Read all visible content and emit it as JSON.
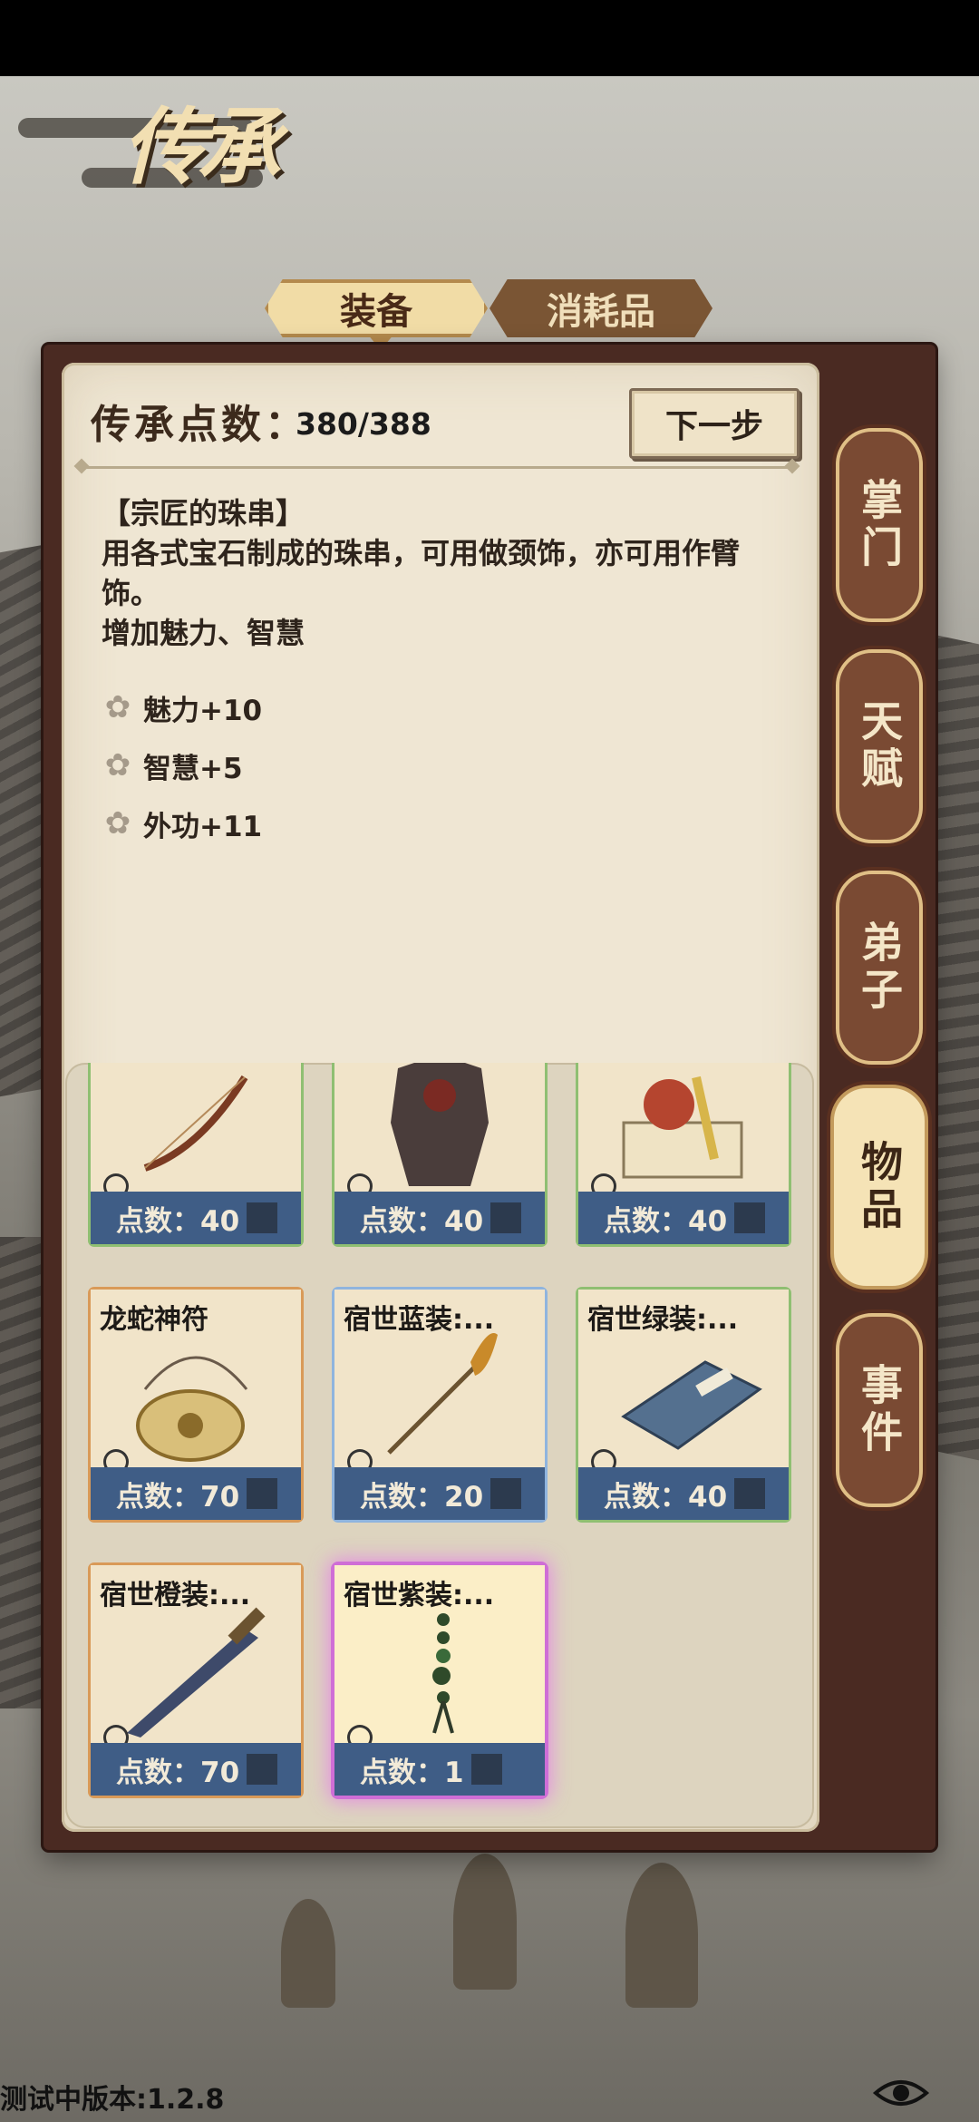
{
  "header": {
    "title": "传承"
  },
  "tabs": [
    {
      "label": "装备",
      "active": true
    },
    {
      "label": "消耗品",
      "active": false
    }
  ],
  "points": {
    "label": "传承点数：",
    "value": "380/388"
  },
  "next_button": {
    "label": "下一步"
  },
  "item_detail": {
    "name": "【宗匠的珠串】",
    "description": "用各式宝石制成的珠串，可用做颈饰，亦可用作臂饰。",
    "effect": "增加魅力、智慧",
    "stats": [
      "魅力+10",
      "智慧+5",
      "外功+11"
    ]
  },
  "items": [
    {
      "name": "",
      "points_label": "点数：40",
      "frame": "green",
      "icon": "bow-icon"
    },
    {
      "name": "",
      "points_label": "点数：40",
      "frame": "green",
      "icon": "armor-icon"
    },
    {
      "name": "",
      "points_label": "点数：40",
      "frame": "green",
      "icon": "seal-icon"
    },
    {
      "name": "龙蛇神符",
      "points_label": "点数：70",
      "frame": "orange",
      "icon": "amulet-icon"
    },
    {
      "name": "宿世蓝装:...",
      "points_label": "点数：20",
      "frame": "blue",
      "icon": "hairpin-icon"
    },
    {
      "name": "宿世绿装:...",
      "points_label": "点数：40",
      "frame": "green",
      "icon": "book-icon"
    },
    {
      "name": "宿世橙装:...",
      "points_label": "点数：70",
      "frame": "orange",
      "icon": "sword-icon"
    },
    {
      "name": "宿世紫装:...",
      "points_label": "点数：1",
      "frame": "purple",
      "icon": "bead-string-icon"
    }
  ],
  "side_tabs": [
    {
      "label": "掌门",
      "active": false
    },
    {
      "label": "天赋",
      "active": false
    },
    {
      "label": "弟子",
      "active": false
    },
    {
      "label": "物品",
      "active": true
    },
    {
      "label": "事件",
      "active": false
    }
  ],
  "footer": {
    "version": "测试中版本:1.2.8"
  },
  "colors": {
    "panel": "#efe6d3",
    "frame": "#4a2a22",
    "points_bar": "#3f5d86",
    "accent": "#f1dca6"
  }
}
